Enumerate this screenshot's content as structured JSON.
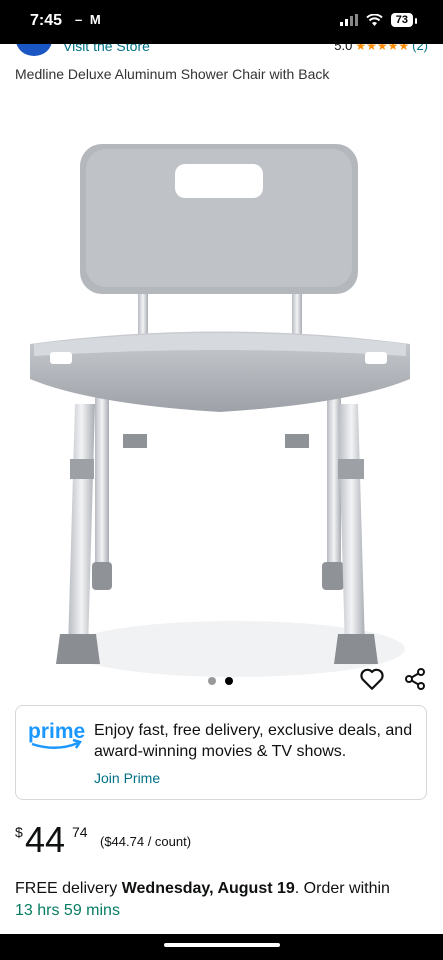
{
  "status_bar": {
    "time": "7:45",
    "notifications": "– M",
    "battery": "73"
  },
  "store": {
    "link_text": "Visit the Store",
    "rating": "5.0",
    "stars": "★★★★★",
    "review_count": "(2)"
  },
  "product": {
    "title": "Medline Deluxe Aluminum Shower Chair with Back",
    "image_count": 2,
    "active_image": 2
  },
  "prime": {
    "logo_text": "prime",
    "message": "Enjoy fast, free delivery, exclusive deals, and award-winning movies & TV shows.",
    "join_label": "Join Prime"
  },
  "price": {
    "currency": "$",
    "whole": "44",
    "fraction": "74",
    "unit_price": "($44.74 / count)"
  },
  "delivery": {
    "prefix": "FREE delivery ",
    "date": "Wednesday, August 19",
    "suffix": ". Order within",
    "countdown": "13 hrs 59 mins"
  },
  "colors": {
    "link": "#007185",
    "star": "#ff8c00",
    "prime_blue": "#1a98ff",
    "countdown": "#067d62"
  }
}
